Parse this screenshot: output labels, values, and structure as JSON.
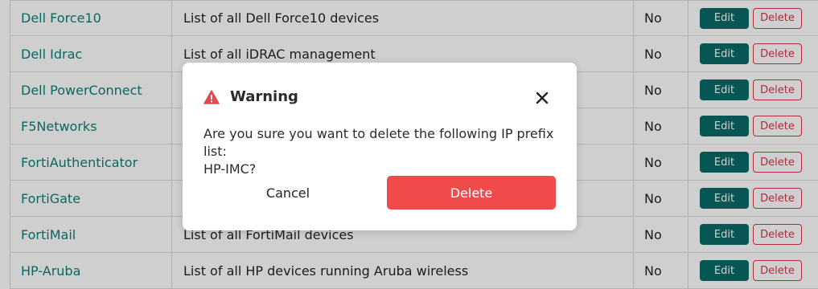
{
  "table": {
    "rows": [
      {
        "name": "Dell Force10",
        "description": "List of all Dell Force10 devices",
        "default": "No"
      },
      {
        "name": "Dell Idrac",
        "description": "List of all iDRAC management",
        "default": "No"
      },
      {
        "name": "Dell PowerConnect",
        "description": "",
        "default": "No"
      },
      {
        "name": "F5Networks",
        "description": "",
        "default": "No"
      },
      {
        "name": "FortiAuthenticator",
        "description": "",
        "default": "No"
      },
      {
        "name": "FortiGate",
        "description": "",
        "default": "No"
      },
      {
        "name": "FortiMail",
        "description": "List of all FortiMail devices",
        "default": "No"
      },
      {
        "name": "HP-Aruba",
        "description": "List of all HP devices running Aruba wireless",
        "default": "No"
      }
    ],
    "edit_label": "Edit",
    "delete_label": "Delete"
  },
  "modal": {
    "title": "Warning",
    "icon": "warning-triangle-icon",
    "close_icon": "close-icon",
    "message_line1": "Are you sure you want to delete the following IP prefix list:",
    "message_line2": "HP-IMC?",
    "cancel_label": "Cancel",
    "delete_label": "Delete"
  },
  "colors": {
    "link": "#0e7f77",
    "edit_button": "#0b6b68",
    "delete_outline": "#dc3545",
    "modal_delete": "#ef4b4b",
    "warning_icon": "#e5484d"
  }
}
